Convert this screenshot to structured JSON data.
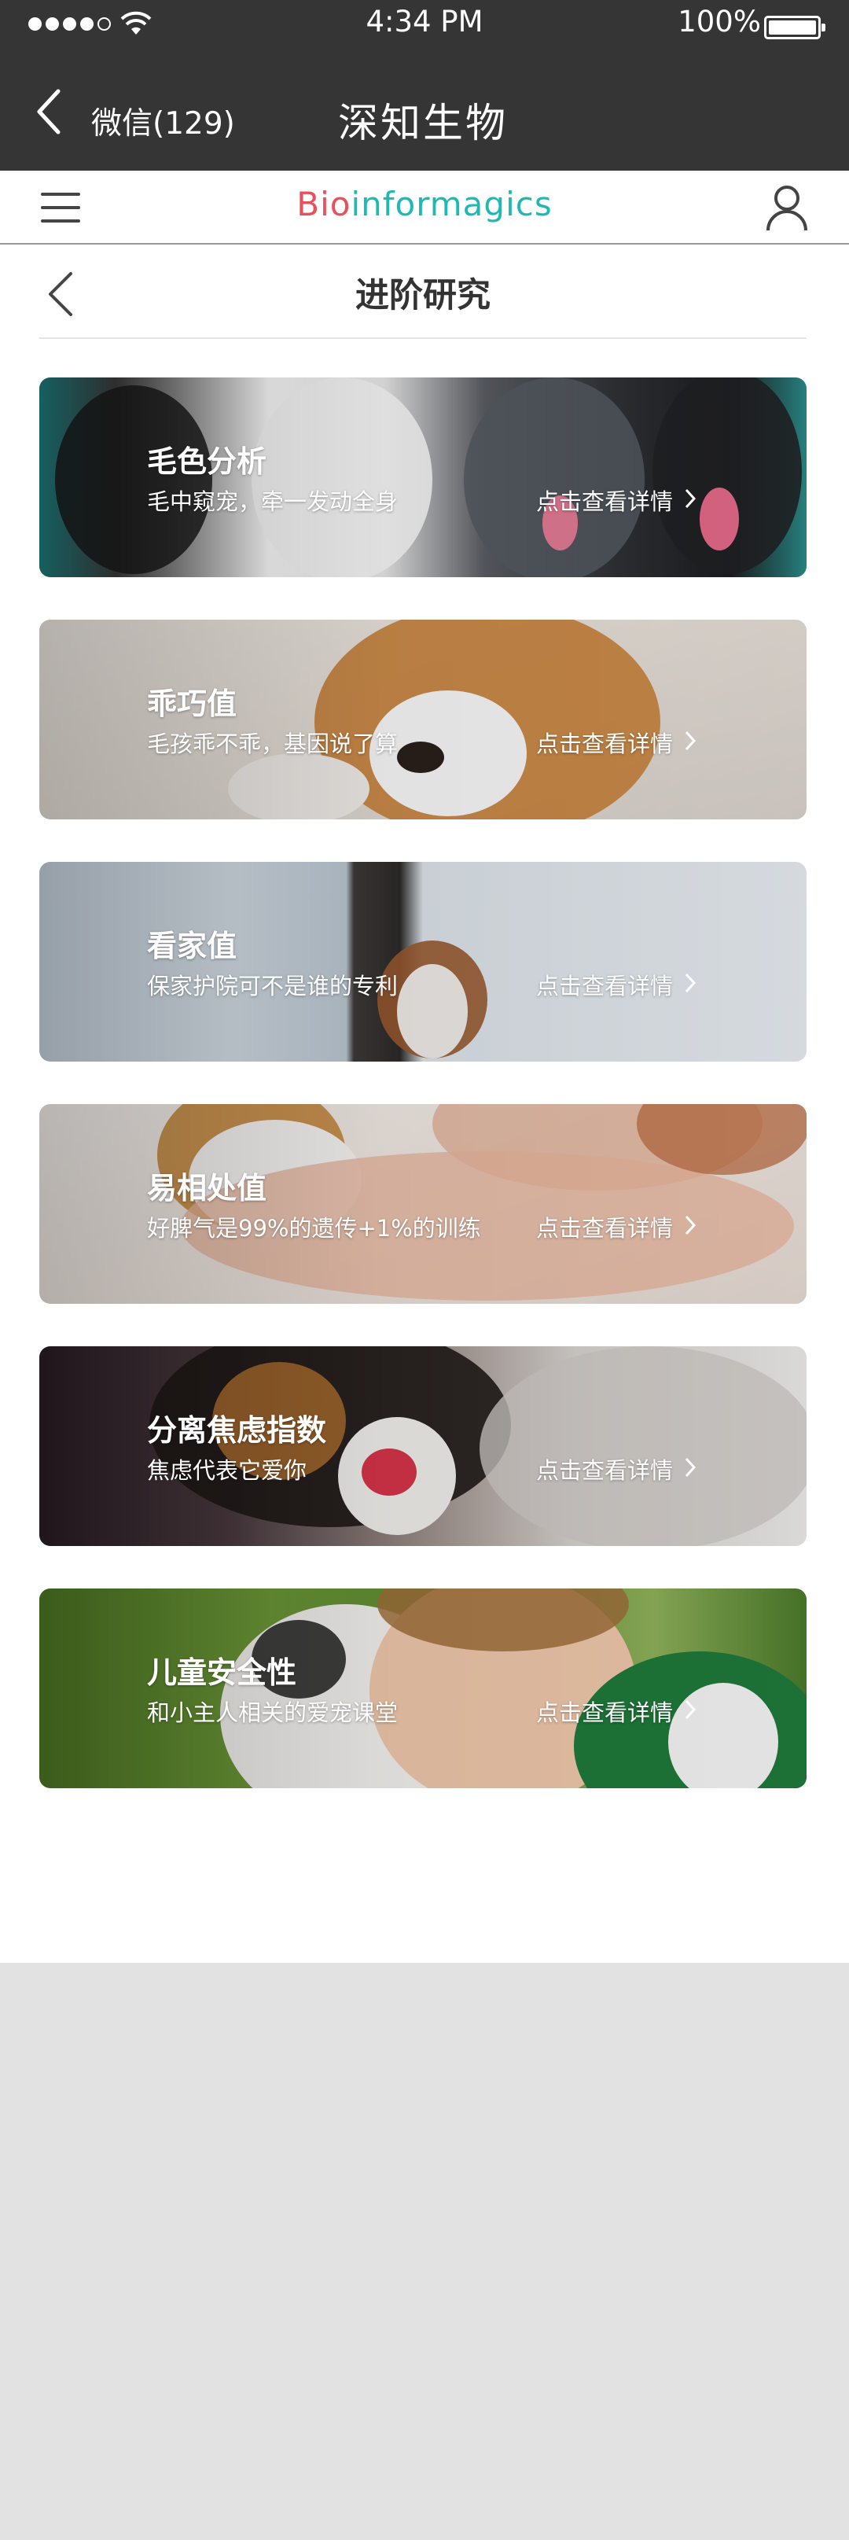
{
  "status_bar": {
    "time": "4:34 PM",
    "battery": "100%"
  },
  "wechat_header": {
    "back_label": "微信(129)",
    "title": "深知生物"
  },
  "app_nav": {
    "logo_prefix": "Bio",
    "logo_suffix": "informagics",
    "brand_red": "#e8505b",
    "brand_teal": "#1fb9b4"
  },
  "section": {
    "title": "进阶研究"
  },
  "cards": [
    {
      "title": "毛色分析",
      "subtitle": "毛中窥宠，牵一发动全身",
      "detail": "点击查看详情"
    },
    {
      "title": "乖巧值",
      "subtitle": "毛孩乖不乖，基因说了算",
      "detail": "点击查看详情"
    },
    {
      "title": "看家值",
      "subtitle": "保家护院可不是谁的专利",
      "detail": "点击查看详情"
    },
    {
      "title": "易相处值",
      "subtitle": "好脾气是99%的遗传+1%的训练",
      "detail": "点击查看详情"
    },
    {
      "title": "分离焦虑指数",
      "subtitle": "焦虑代表它爱你",
      "detail": "点击查看详情"
    },
    {
      "title": "儿童安全性",
      "subtitle": "和小主人相关的爱宠课堂",
      "detail": "点击查看详情"
    }
  ]
}
